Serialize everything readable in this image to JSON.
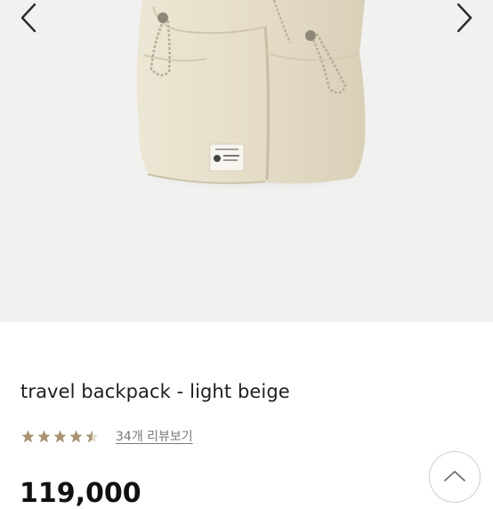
{
  "gallery": {
    "prev_icon": "chevron-left-icon",
    "next_icon": "chevron-right-icon"
  },
  "product": {
    "title": "travel backpack - light beige",
    "rating": 4.5,
    "review_link": "34개 리뷰보기",
    "price": "119,000"
  },
  "colors": {
    "star": "#a79572",
    "gallery_bg": "#f1f1ef",
    "bag": "#e7e0cd"
  },
  "scroll_top": {
    "icon": "chevron-up-icon"
  }
}
